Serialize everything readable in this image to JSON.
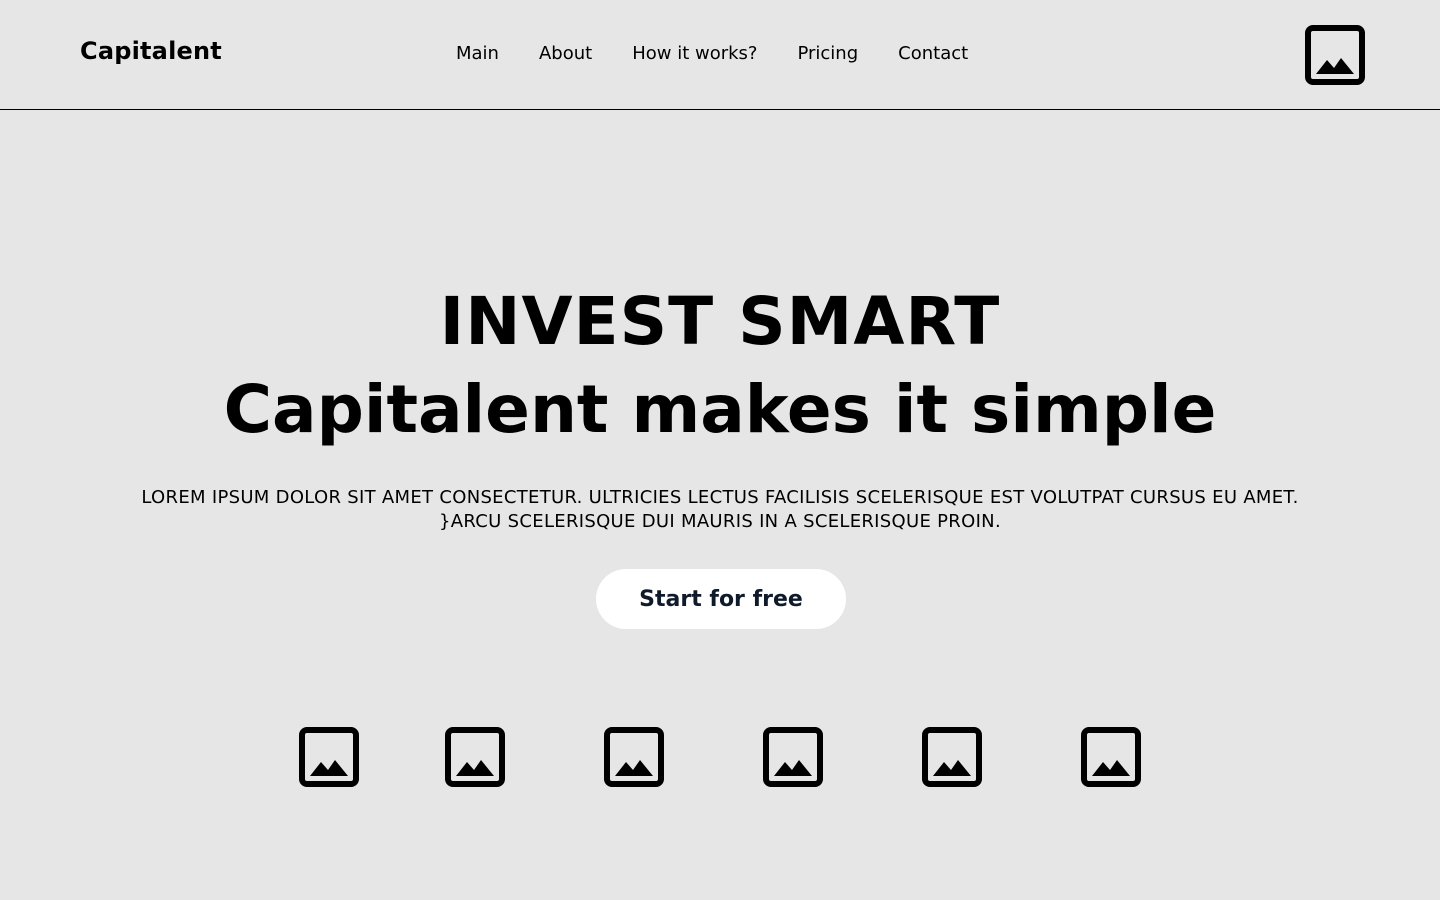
{
  "header": {
    "brand": "Capitalent",
    "nav": [
      {
        "label": "Main"
      },
      {
        "label": "About"
      },
      {
        "label": "How it works?"
      },
      {
        "label": "Pricing"
      },
      {
        "label": "Contact"
      }
    ],
    "image_icon": "image-placeholder-icon"
  },
  "hero": {
    "title_line1": "INVEST SMART",
    "title_line2": "Capitalent makes it simple",
    "body_line1": "LOREM IPSUM DOLOR SIT AMET CONSECTETUR. ULTRICIES LECTUS FACILISIS SCELERISQUE EST VOLUTPAT CURSUS EU AMET.",
    "body_line2": "}ARCU SCELERISQUE DUI MAURIS IN A SCELERISQUE PROIN.",
    "cta_label": "Start for free"
  },
  "logos": {
    "icon": "image-placeholder-icon",
    "count": 6
  },
  "colors": {
    "background": "#e6e6e6",
    "text": "#000000",
    "button_bg": "#ffffff",
    "button_text": "#0f1a2a"
  }
}
